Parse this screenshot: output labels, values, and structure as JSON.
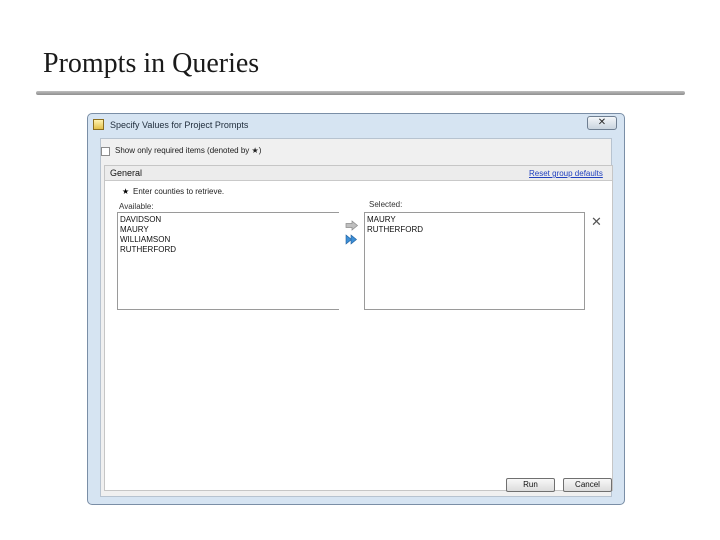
{
  "slide": {
    "title": "Prompts in Queries"
  },
  "dialog": {
    "title": "Specify Values for Project Prompts",
    "close_label": "✕",
    "show_required_label": "Show only required items (denoted by ★)",
    "group": {
      "name": "General",
      "reset_label": "Reset group defaults",
      "prompt_marker": "★",
      "prompt_text": "Enter counties to retrieve.",
      "available_label": "Available:",
      "selected_label": "Selected:",
      "available_items": [
        "DAVIDSON",
        "MAURY",
        "WILLIAMSON",
        "RUTHERFORD"
      ],
      "selected_items": [
        "MAURY",
        "RUTHERFORD"
      ]
    },
    "buttons": {
      "run": "Run",
      "cancel": "Cancel"
    }
  },
  "colors": {
    "link": "#1f3fbf",
    "arrow": "#3d8fd6",
    "dialog_frame": "#d6e4f2"
  },
  "icons": {
    "move_one": "right-arrow-icon",
    "move_all": "double-right-arrow-icon",
    "clear": "clear-x-icon",
    "app": "prompt-app-icon"
  }
}
